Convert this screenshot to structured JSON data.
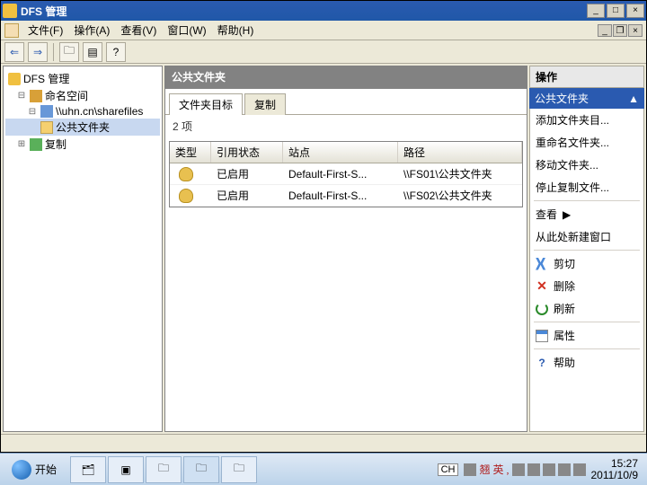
{
  "window": {
    "title": "DFS 管理"
  },
  "menubar": {
    "file": "文件(F)",
    "action": "操作(A)",
    "view": "查看(V)",
    "window": "窗口(W)",
    "help": "帮助(H)"
  },
  "tree": {
    "root": "DFS 管理",
    "namespace": "命名空间",
    "server": "\\\\uhn.cn\\sharefiles",
    "folder": "公共文件夹",
    "replication": "复制"
  },
  "center": {
    "header": "公共文件夹",
    "tab_targets": "文件夹目标",
    "tab_replication": "复制",
    "count": "2 项",
    "columns": {
      "type": "类型",
      "ref": "引用状态",
      "site": "站点",
      "path": "路径"
    },
    "rows": [
      {
        "ref": "已启用",
        "site": "Default-First-S...",
        "path": "\\\\FS01\\公共文件夹"
      },
      {
        "ref": "已启用",
        "site": "Default-First-S...",
        "path": "\\\\FS02\\公共文件夹"
      }
    ]
  },
  "actions": {
    "title": "操作",
    "subtitle": "公共文件夹",
    "add_target": "添加文件夹目...",
    "rename": "重命名文件夹...",
    "move": "移动文件夹...",
    "stop_repl": "停止复制文件...",
    "view": "查看",
    "new_window": "从此处新建窗口",
    "cut": "剪切",
    "delete": "删除",
    "refresh": "刷新",
    "properties": "属性",
    "help": "帮助"
  },
  "taskbar": {
    "start": "开始",
    "lang": "CH",
    "ime": "翘 英 ,",
    "time": "15:27",
    "date": "2011/10/9"
  }
}
